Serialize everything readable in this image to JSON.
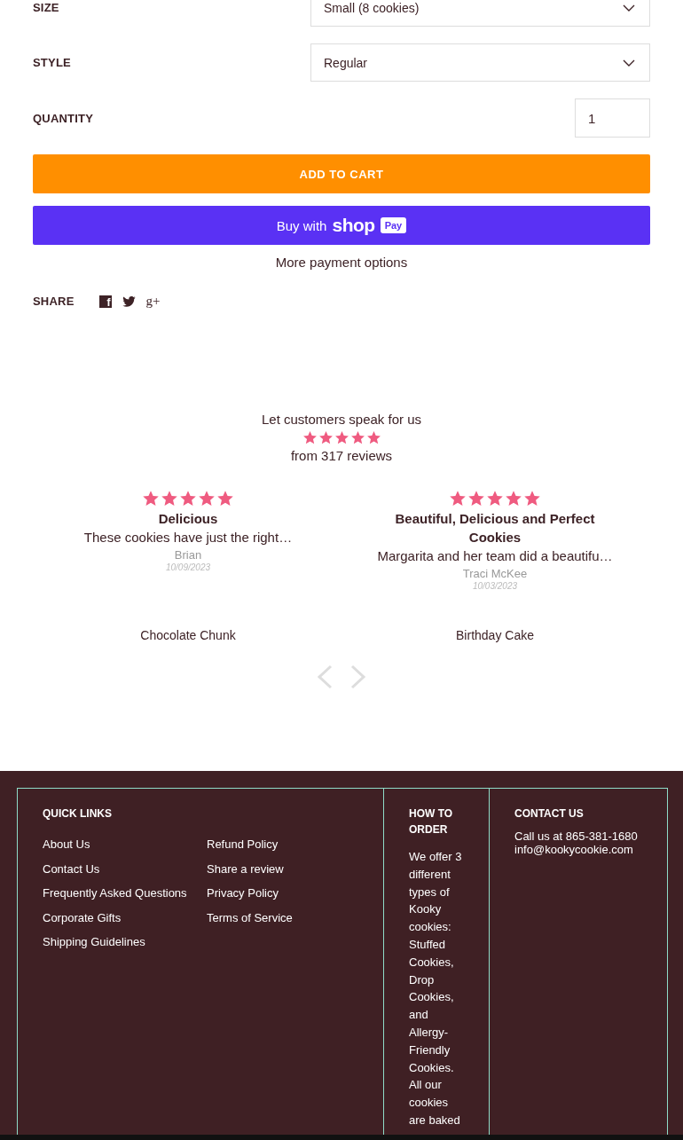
{
  "product_options": [
    {
      "label": "SIZE",
      "value": "Small (8 cookies)"
    },
    {
      "label": "STYLE",
      "value": "Regular"
    }
  ],
  "quantity": {
    "label": "QUANTITY",
    "value": "1"
  },
  "add_to_cart": "ADD TO CART",
  "shop_pay": {
    "prefix": "Buy with",
    "brand": "shop",
    "badge": "Pay"
  },
  "more_payment_options": "More payment options",
  "share": {
    "label": "SHARE",
    "networks": [
      {
        "kind": "facebook",
        "glyph": "f"
      },
      {
        "kind": "twitter"
      },
      {
        "kind": "googleplus",
        "glyph": "g+"
      }
    ]
  },
  "reviews": {
    "heading": "Let customers speak for us",
    "stars": 5,
    "summary": "from 317 reviews",
    "items": [
      {
        "stars": 5,
        "title": "Delicious",
        "body": "These cookies have just the right…",
        "author": "Brian",
        "date": "10/09/2023",
        "product": "Chocolate Chunk"
      },
      {
        "stars": 5,
        "title": "Beautiful, Delicious and Perfect Cookies",
        "body": "Margarita and her team did a beautifu…",
        "author": "Traci McKee",
        "date": "10/03/2023",
        "product": "Birthday Cake"
      }
    ]
  },
  "footer": {
    "quick_links": {
      "title": "QUICK LINKS",
      "links": [
        "About Us",
        "Contact Us",
        "Frequently Asked Questions",
        "Corporate Gifts",
        "Shipping Guidelines",
        "Refund Policy",
        "Share a review",
        "Privacy Policy",
        "Terms of Service"
      ]
    },
    "how_to_order": {
      "title": "HOW TO ORDER",
      "text": "We offer 3 different types of Kooky cookies: Stuffed Cookies, Drop Cookies, and Allergy-Friendly Cookies. All our cookies are baked"
    },
    "contact": {
      "title": "CONTACT US",
      "lines": [
        "Call us at 865-381-1680",
        "info@kookycookie.com"
      ]
    }
  }
}
